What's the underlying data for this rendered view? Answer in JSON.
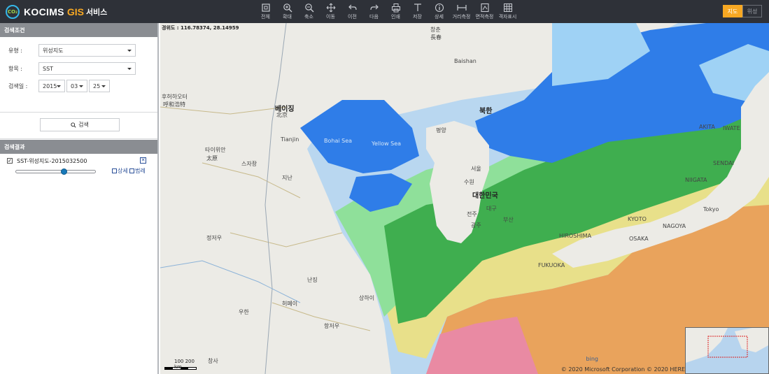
{
  "app": {
    "logo_mark": "CO₂",
    "logo_name": "KOCIMS",
    "logo_gis": "GIS",
    "logo_service": "서비스"
  },
  "toolbar": [
    {
      "icon": "full-extent-icon",
      "label": "전체"
    },
    {
      "icon": "zoom-in-icon",
      "label": "확대"
    },
    {
      "icon": "zoom-out-icon",
      "label": "축소"
    },
    {
      "icon": "pan-icon",
      "label": "이동"
    },
    {
      "icon": "previous-icon",
      "label": "이전"
    },
    {
      "icon": "next-icon",
      "label": "다음"
    },
    {
      "icon": "print-icon",
      "label": "인쇄"
    },
    {
      "icon": "save-icon",
      "label": "저장"
    },
    {
      "icon": "info-icon",
      "label": "상세"
    },
    {
      "icon": "distance-icon",
      "label": "거리측정"
    },
    {
      "icon": "area-icon",
      "label": "면적측정"
    },
    {
      "icon": "grid-icon",
      "label": "격자표시"
    }
  ],
  "map_type": {
    "map_label": "지도",
    "satellite_label": "위성",
    "active": "map"
  },
  "search_panel": {
    "header": "검색조건",
    "type_label": "유형 :",
    "type_value": "위성지도",
    "item_label": "항목 :",
    "item_value": "SST",
    "date_label": "검색일 :",
    "year": "2015",
    "month": "03",
    "day": "25",
    "search_button": "검색"
  },
  "results_panel": {
    "header": "검색결과",
    "items": [
      {
        "name": "SST-위성지도-2015032500",
        "checked": true,
        "opacity_fraction": 0.62,
        "detail_label": "상세",
        "legend_label": "범례"
      }
    ]
  },
  "map": {
    "coordinate_readout": "경위도 : 116.78374, 28.14959",
    "labels": {
      "beijing": "베이징",
      "beijing_en": "北京",
      "bohai": "Bohai Sea",
      "yellow": "Yellow Sea",
      "north_korea": "북한",
      "south_korea": "대한민국",
      "seoul": "서울",
      "tianjin": "Tianjin",
      "shanghai": "상하이",
      "nanjing": "난징",
      "wuhan": "우한",
      "hohhot": "후허하오터",
      "hohhot_cn": "呼和浩特",
      "taiyuan": "타이위안",
      "taiyuan_cn": "太原",
      "shijiazhuang": "스자좡",
      "jinan": "지난",
      "zhengzhou": "정저우",
      "changchun": "창춘",
      "changchun_cn": "長春",
      "pyongyang": "평양",
      "tokyo": "Tokyo",
      "nagoya": "NAGOYA",
      "osaka": "OSAKA",
      "fukuoka": "FUKUOKA",
      "hiroshima": "HIROSHIMA",
      "kyoto": "KYOTO",
      "niigata": "NIIGATA",
      "sendai": "SENDAI",
      "iwate": "IWATE",
      "akita": "AKITA",
      "busan": "부산",
      "daegu": "대구",
      "gwangju": "광주",
      "jeonju": "전주",
      "hefei": "허페이",
      "hangzhou": "항저우",
      "changsha": "창사",
      "baishan": "Baishan",
      "suwon": "수원"
    },
    "scale_label": "100 200 km",
    "bing_label": "bing",
    "copyright": "© 2020 Microsoft Corporation © 2020 HERE © 2020 Zenrin Terms of Use"
  },
  "colors": {
    "topbar": "#2e3138",
    "accent": "#f7a823",
    "panel_header": "#8a8d92",
    "sst_blue": "#2f7de8",
    "sst_lightblue": "#9fd2f5",
    "sst_green": "#3fae4f",
    "sst_lightgreen": "#8fe09a",
    "sst_yellow": "#e8e08a",
    "sst_orange": "#e9a35c",
    "sst_pink": "#e98aa3"
  }
}
